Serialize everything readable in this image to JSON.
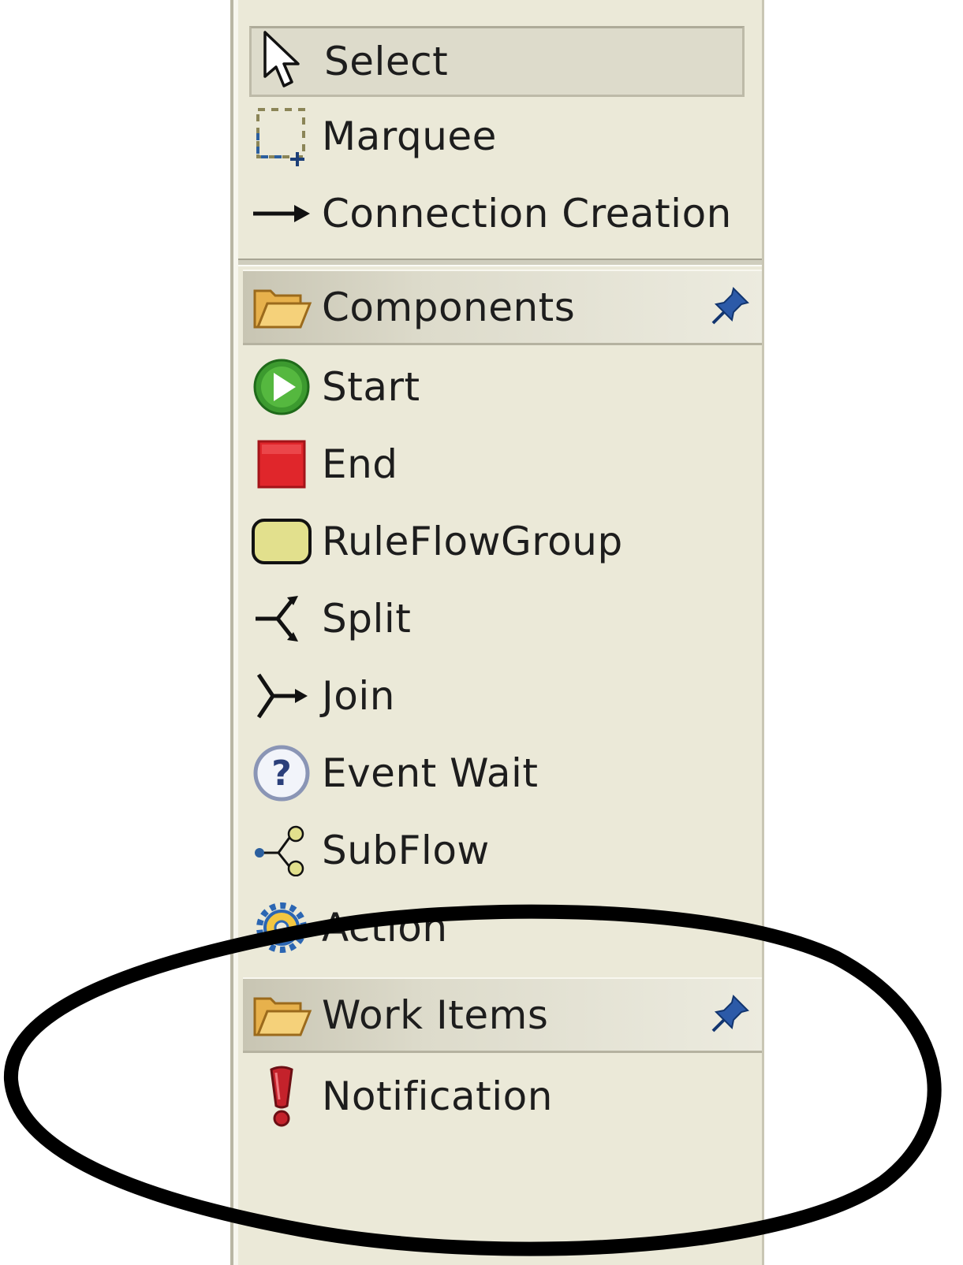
{
  "palette": {
    "tools": [
      {
        "label": "Select",
        "icon": "arrow-pointer-icon",
        "selected": true
      },
      {
        "label": "Marquee",
        "icon": "marquee-icon"
      },
      {
        "label": "Connection Creation",
        "icon": "connection-arrow-icon"
      }
    ],
    "drawers": [
      {
        "title": "Components",
        "icon": "folder-open-icon",
        "pinned": true,
        "items": [
          {
            "label": "Start",
            "icon": "start-icon",
            "color": "#3c9a2f"
          },
          {
            "label": "End",
            "icon": "end-icon",
            "color": "#e0262b"
          },
          {
            "label": "RuleFlowGroup",
            "icon": "ruleflowgroup-icon",
            "color": "#e2e08d"
          },
          {
            "label": "Split",
            "icon": "split-icon"
          },
          {
            "label": "Join",
            "icon": "join-icon"
          },
          {
            "label": "Event Wait",
            "icon": "question-icon"
          },
          {
            "label": "SubFlow",
            "icon": "subflow-icon"
          },
          {
            "label": "Action",
            "icon": "gear-icon"
          }
        ]
      },
      {
        "title": "Work Items",
        "icon": "folder-open-icon",
        "pinned": true,
        "items": [
          {
            "label": "Notification",
            "icon": "exclamation-icon",
            "color": "#c4222b"
          }
        ]
      }
    ]
  },
  "annotation": {
    "shape": "ellipse",
    "color": "#000000"
  }
}
